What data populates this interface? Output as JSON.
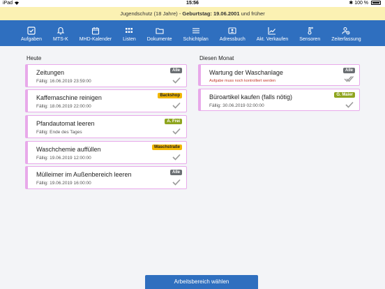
{
  "statusbar": {
    "device": "iPad",
    "time": "15:56",
    "battery": "100 %"
  },
  "banner": {
    "prefix": "Jugendschutz (18 Jahre) - ",
    "birthday_label": "Geburtstag: 19.06.2001",
    "suffix": " und früher"
  },
  "nav": [
    {
      "label": "Aufgaben",
      "icon": "checkbox-icon"
    },
    {
      "label": "MTS-K",
      "icon": "bell-icon"
    },
    {
      "label": "MHD-Kalender",
      "icon": "calendar-icon"
    },
    {
      "label": "Listen",
      "icon": "grid-icon"
    },
    {
      "label": "Dokumente",
      "icon": "folder-icon"
    },
    {
      "label": "Schichtplan",
      "icon": "lines-icon"
    },
    {
      "label": "Adressbuch",
      "icon": "contact-card-icon"
    },
    {
      "label": "Akt. Verkaufen",
      "icon": "trend-chart-icon"
    },
    {
      "label": "Sensoren",
      "icon": "thermometer-icon"
    },
    {
      "label": "Zeiterfassung",
      "icon": "user-clock-icon"
    }
  ],
  "sections": {
    "today": "Heute",
    "month": "Diesen Monat"
  },
  "today_tasks": [
    {
      "title": "Zeitungen",
      "due": "Fällig: 16.06.2019 23:59:00",
      "badge": "Alle",
      "badge_color": "#6b6f73"
    },
    {
      "title": "Kaffemaschine reinigen",
      "due": "Fällig: 18.06.2019 22:00:00",
      "badge": "Backshop",
      "badge_color": "#f2b705",
      "badge_text_color": "#222"
    },
    {
      "title": "Pfandautomat leeren",
      "due": "Fällig: Ende des Tages",
      "badge": "A. Frei",
      "badge_color": "#8fa51f"
    },
    {
      "title": "Waschchemie auffüllen",
      "due": "Fällig: 19.06.2019 12:00:00",
      "badge": "Waschstraße",
      "badge_color": "#f2b705",
      "badge_text_color": "#222"
    },
    {
      "title": "Mülleimer im Außenbereich leeren",
      "due": "Fällig: 19.06.2019 16:00:00",
      "badge": "Alle",
      "badge_color": "#6b6f73"
    }
  ],
  "month_tasks": [
    {
      "title": "Wartung der Waschanlage",
      "note": "Aufgabe muss noch kontrolliert werden",
      "badge": "Alle",
      "badge_color": "#6b6f73"
    },
    {
      "title": "Büroartikel kaufen (falls nötig)",
      "due": "Fällig: 30.06.2019 02:00:00",
      "badge": "G. Maier",
      "badge_color": "#8fa51f"
    }
  ],
  "bottom_button": "Arbeitsbereich wählen",
  "colors": {
    "nav_bg": "#2f6fbf",
    "card_border": "#e8a9ea",
    "banner_bg": "#fbf1b3"
  }
}
